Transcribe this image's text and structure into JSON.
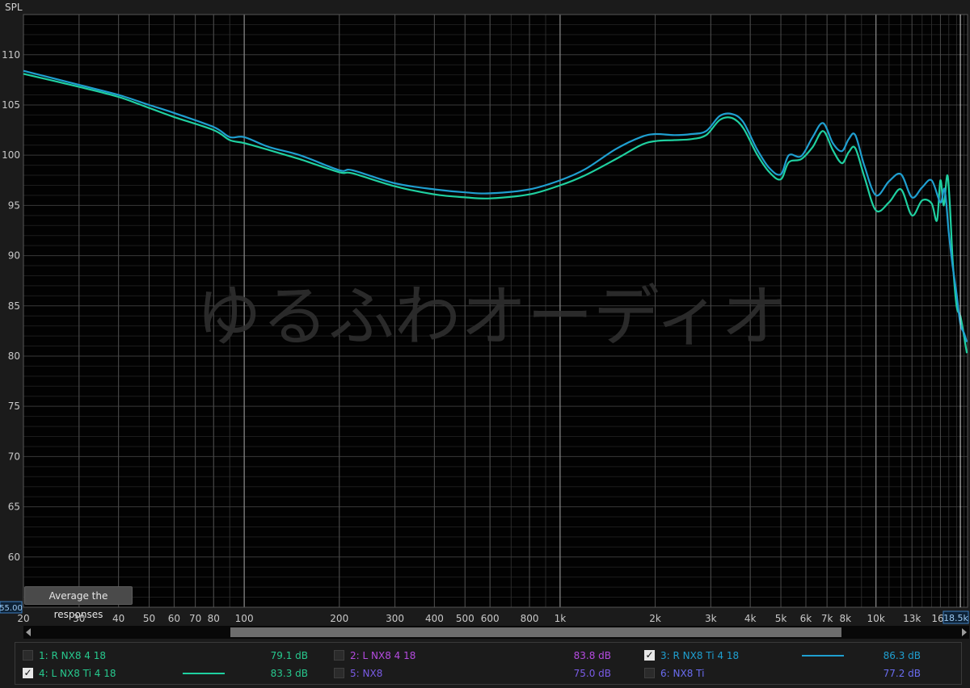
{
  "chart_data": {
    "type": "line",
    "ylabel": "SPL",
    "x_scale": "log",
    "xlim": [
      20,
      19500
    ],
    "ylim": [
      55,
      114
    ],
    "x_ticks": [
      20,
      30,
      40,
      50,
      60,
      70,
      80,
      100,
      200,
      300,
      400,
      500,
      600,
      800,
      1000,
      2000,
      3000,
      4000,
      5000,
      6000,
      7000,
      8000,
      10000,
      13000,
      16000
    ],
    "x_tick_labels": [
      "20",
      "30",
      "40",
      "50",
      "60",
      "70",
      "80",
      "100",
      "200",
      "300",
      "400",
      "500",
      "600",
      "800",
      "1k",
      "2k",
      "3k",
      "4k",
      "5k",
      "6k",
      "7k",
      "8k",
      "10k",
      "13k",
      "16k"
    ],
    "y_ticks": [
      60,
      65,
      70,
      75,
      80,
      85,
      90,
      95,
      100,
      105,
      110
    ],
    "y_tick_labels": [
      "60",
      "65",
      "70",
      "75",
      "80",
      "85",
      "90",
      "95",
      "100",
      "105",
      "110"
    ],
    "y_cursor_label": "55.00",
    "x_cursor_label": "18.5k",
    "grid": true,
    "watermark": "ゆるふわオーディオ",
    "series": [
      {
        "name": "3: R NX8 Ti 4 18",
        "color": "#1f9fd0",
        "x": [
          20,
          30,
          40,
          50,
          60,
          80,
          90,
          100,
          120,
          150,
          200,
          220,
          300,
          400,
          500,
          600,
          800,
          1000,
          1200,
          1500,
          1800,
          2000,
          2300,
          2600,
          2900,
          3200,
          3500,
          3800,
          4200,
          4600,
          5000,
          5300,
          5800,
          6300,
          6800,
          7300,
          7800,
          8200,
          8600,
          9200,
          10000,
          11000,
          12000,
          13000,
          14000,
          15000,
          16000,
          16500,
          17000,
          17500,
          18000,
          18500,
          19000,
          19400
        ],
        "y": [
          108.4,
          107,
          106,
          105,
          104.2,
          102.8,
          101.8,
          101.8,
          100.8,
          100.0,
          98.5,
          98.5,
          97.2,
          96.6,
          96.3,
          96.2,
          96.6,
          97.5,
          98.6,
          100.6,
          101.8,
          102.1,
          102.0,
          102.1,
          102.4,
          103.9,
          104.1,
          103.3,
          100.6,
          98.7,
          98.1,
          100.0,
          99.9,
          101.8,
          103.2,
          101.2,
          100.4,
          101.6,
          102.0,
          98.9,
          96.0,
          97.4,
          98.1,
          95.8,
          96.8,
          97.5,
          95.3,
          96.6,
          92.3,
          88.9,
          86.2,
          83.2,
          82.3,
          81.4
        ]
      },
      {
        "name": "4: L NX8 Ti 4 18",
        "color": "#1fd0a0",
        "x": [
          20,
          30,
          40,
          50,
          60,
          80,
          90,
          100,
          120,
          150,
          200,
          220,
          300,
          400,
          500,
          600,
          800,
          1000,
          1200,
          1500,
          1800,
          2000,
          2300,
          2600,
          2900,
          3200,
          3500,
          3800,
          4200,
          4600,
          5000,
          5300,
          5800,
          6300,
          6800,
          7300,
          7800,
          8200,
          8600,
          9200,
          10000,
          11000,
          12000,
          13000,
          14000,
          15000,
          15600,
          16000,
          16400,
          16800,
          17100,
          17500,
          18000,
          18500,
          19000,
          19400
        ],
        "y": [
          108.1,
          106.8,
          105.8,
          104.7,
          103.8,
          102.5,
          101.5,
          101.2,
          100.5,
          99.6,
          98.3,
          98.2,
          96.9,
          96.1,
          95.8,
          95.7,
          96.1,
          97.0,
          98.0,
          99.6,
          101.0,
          101.4,
          101.5,
          101.6,
          102.0,
          103.5,
          103.7,
          102.7,
          100.1,
          98.3,
          97.6,
          99.3,
          99.6,
          100.8,
          102.4,
          100.5,
          99.2,
          100.3,
          100.7,
          97.8,
          94.5,
          95.3,
          96.6,
          94.0,
          95.5,
          95.2,
          93.5,
          97.5,
          95.0,
          98.0,
          95.6,
          89.5,
          85.0,
          84.0,
          82.0,
          80.3
        ]
      }
    ]
  },
  "ui": {
    "average_button": "Average the responses"
  },
  "legend": [
    {
      "label": "1: R NX8 4 18",
      "value": "79.1 dB",
      "checked": false,
      "color": "#27c98e"
    },
    {
      "label": "2: L NX8 4 18",
      "value": "83.8 dB",
      "checked": false,
      "color": "#b54be0"
    },
    {
      "label": "3: R NX8 Ti 4 18",
      "value": "86.3 dB",
      "checked": true,
      "color": "#1f9fd0"
    },
    {
      "label": "4: L NX8 Ti 4 18",
      "value": "83.3 dB",
      "checked": true,
      "color": "#27c98e"
    },
    {
      "label": "5: NX8",
      "value": "75.0 dB",
      "checked": false,
      "color": "#7a5be6"
    },
    {
      "label": "6: NX8 Ti",
      "value": "77.2 dB",
      "checked": false,
      "color": "#6a6cf0"
    }
  ]
}
